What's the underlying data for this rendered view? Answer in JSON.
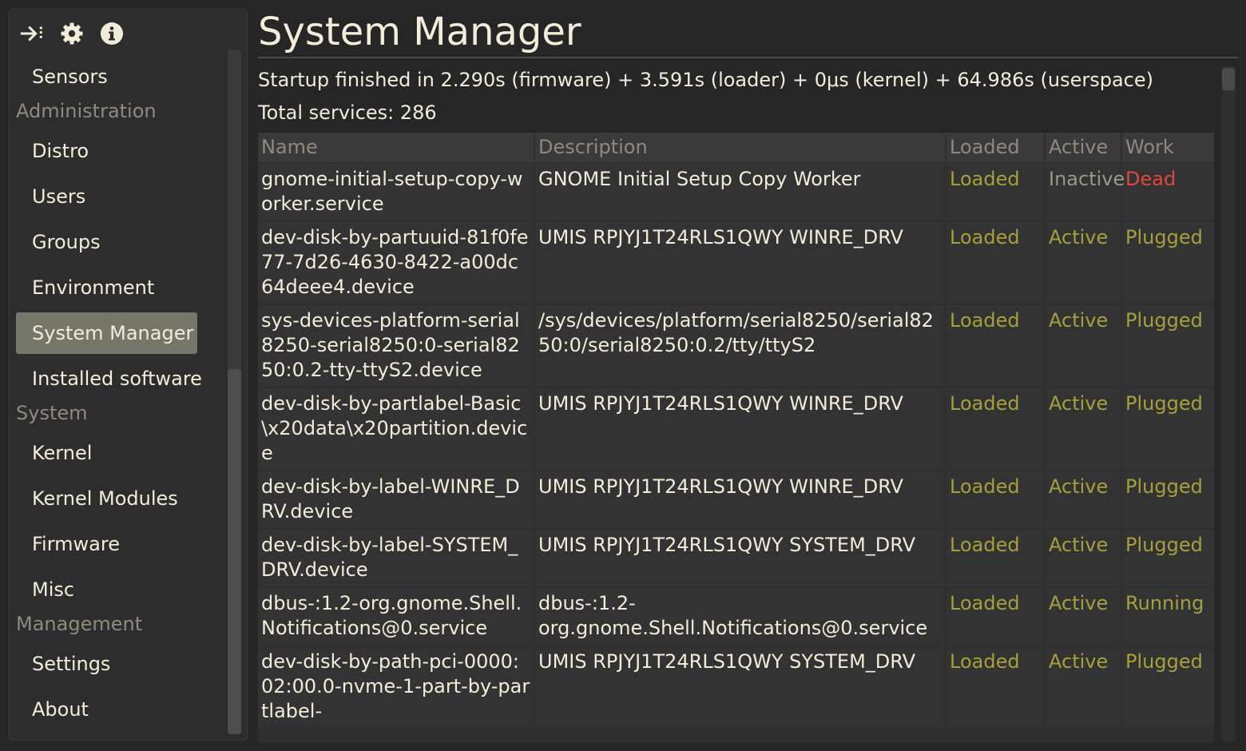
{
  "toolbar": {
    "icons": [
      "login-arrow-icon",
      "gear-icon",
      "info-icon"
    ]
  },
  "sidebar": {
    "top_items": [
      {
        "label": "Sensors"
      }
    ],
    "sections": [
      {
        "title": "Administration",
        "items": [
          {
            "label": "Distro"
          },
          {
            "label": "Users"
          },
          {
            "label": "Groups"
          },
          {
            "label": "Environment"
          },
          {
            "label": "System Manager",
            "active": true
          },
          {
            "label": "Installed software"
          }
        ]
      },
      {
        "title": "System",
        "items": [
          {
            "label": "Kernel"
          },
          {
            "label": "Kernel Modules"
          },
          {
            "label": "Firmware"
          },
          {
            "label": "Misc"
          }
        ]
      },
      {
        "title": "Management",
        "items": [
          {
            "label": "Settings"
          },
          {
            "label": "About"
          }
        ]
      }
    ]
  },
  "main": {
    "title": "System Manager",
    "startup": "Startup finished in 2.290s (firmware) + 3.591s (loader) + 0μs (kernel) + 64.986s (userspace)",
    "total_services": "Total services: 286",
    "columns": [
      "Name",
      "Description",
      "Loaded",
      "Active",
      "Work"
    ],
    "rows": [
      {
        "name": "gnome-initial-setup-copy-worker.service",
        "description": "GNOME Initial Setup Copy Worker",
        "loaded": "Loaded",
        "active": "Inactive",
        "work": "Dead"
      },
      {
        "name": "dev-disk-by-partuuid-81f0fe77-7d26-4630-8422-a00dc64deee4.device",
        "description": "UMIS RPJYJ1T24RLS1QWY WINRE_DRV",
        "loaded": "Loaded",
        "active": "Active",
        "work": "Plugged"
      },
      {
        "name": "sys-devices-platform-serial8250-serial8250:0-serial8250:0.2-tty-ttyS2.device",
        "description": "/sys/devices/platform/serial8250/serial8250:0/serial8250:0.2/tty/ttyS2",
        "loaded": "Loaded",
        "active": "Active",
        "work": "Plugged"
      },
      {
        "name": "dev-disk-by-partlabel-Basic\\x20data\\x20partition.device",
        "description": "UMIS RPJYJ1T24RLS1QWY WINRE_DRV",
        "loaded": "Loaded",
        "active": "Active",
        "work": "Plugged"
      },
      {
        "name": "dev-disk-by-label-WINRE_DRV.device",
        "description": "UMIS RPJYJ1T24RLS1QWY WINRE_DRV",
        "loaded": "Loaded",
        "active": "Active",
        "work": "Plugged"
      },
      {
        "name": "dev-disk-by-label-SYSTEM_DRV.device",
        "description": "UMIS RPJYJ1T24RLS1QWY SYSTEM_DRV",
        "loaded": "Loaded",
        "active": "Active",
        "work": "Plugged"
      },
      {
        "name": "dbus-:1.2-org.gnome.Shell.Notifications@0.service",
        "description": "dbus-:1.2-org.gnome.Shell.Notifications@0.service",
        "loaded": "Loaded",
        "active": "Active",
        "work": "Running"
      },
      {
        "name": "dev-disk-by-path-pci-0000:02:00.0-nvme-1-part-by-partlabel-",
        "description": "UMIS RPJYJ1T24RLS1QWY SYSTEM_DRV",
        "loaded": "Loaded",
        "active": "Active",
        "work": "Plugged"
      }
    ],
    "status_colors": {
      "loaded": "#a6a03c",
      "active": "#a6a03c",
      "inactive": "#9b968a",
      "dead": "#e0473f",
      "plugged": "#a6a03c",
      "running": "#a6a03c"
    }
  }
}
